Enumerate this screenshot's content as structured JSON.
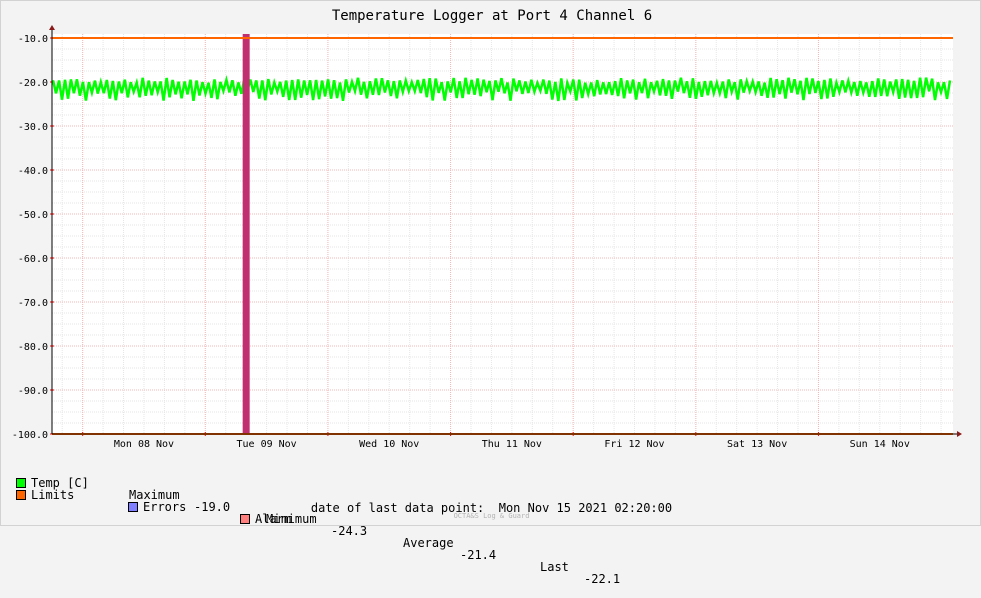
{
  "chart_data": {
    "type": "line",
    "title": "Temperature Logger at Port 4 Channel 6",
    "ylim": [
      -100,
      -10
    ],
    "yticks": [
      "-10.0",
      "-20.0",
      "-30.0",
      "-40.0",
      "-50.0",
      "-60.0",
      "-70.0",
      "-80.0",
      "-90.0",
      "-100.0"
    ],
    "xlim": [
      "2021-11-07 18:00",
      "2021-11-15 02:20"
    ],
    "xticks": [
      {
        "label": "Mon 08 Nov",
        "date": "2021-11-08 12:00"
      },
      {
        "label": "Tue 09 Nov",
        "date": "2021-11-09 12:00"
      },
      {
        "label": "Wed 10 Nov",
        "date": "2021-11-10 12:00"
      },
      {
        "label": "Thu 11 Nov",
        "date": "2021-11-11 12:00"
      },
      {
        "label": "Fri 12 Nov",
        "date": "2021-11-12 12:00"
      },
      {
        "label": "Sat 13 Nov",
        "date": "2021-11-13 12:00"
      },
      {
        "label": "Sun 14 Nov",
        "date": "2021-11-14 12:00"
      }
    ],
    "series": [
      {
        "name": "Temp [C]",
        "color": "#00ff00",
        "band_min": -24.3,
        "band_max": -19.0,
        "average": -21.4,
        "last": -22.1
      },
      {
        "name": "Limits",
        "color": "#ff6600",
        "values": [
          -10,
          -100
        ]
      }
    ],
    "alarm_marker": {
      "date": "2021-11-09 08:00",
      "color": "#c03070"
    },
    "grid": true
  },
  "legend": {
    "temp_label": "Temp [C]",
    "max_label": "Maximum",
    "max_value": "-19.0",
    "min_label": "Minimum",
    "min_value": "-24.3",
    "avg_label": "Average",
    "avg_value": "-21.4",
    "last_label": "Last",
    "last_value": "-22.1",
    "limits_label": "Limits",
    "errors_label": "Errors",
    "alarm_label": "Alarm",
    "colors": {
      "temp": "#00ff00",
      "limits": "#ff6600",
      "errors": "#7f7fff",
      "alarm": "#ff7f7f"
    }
  },
  "footer": {
    "date_label": "date of last data point:",
    "date_value": "Mon Nov 15 2021 02:20:00",
    "credit": "OCTA&S Log & Guard"
  }
}
